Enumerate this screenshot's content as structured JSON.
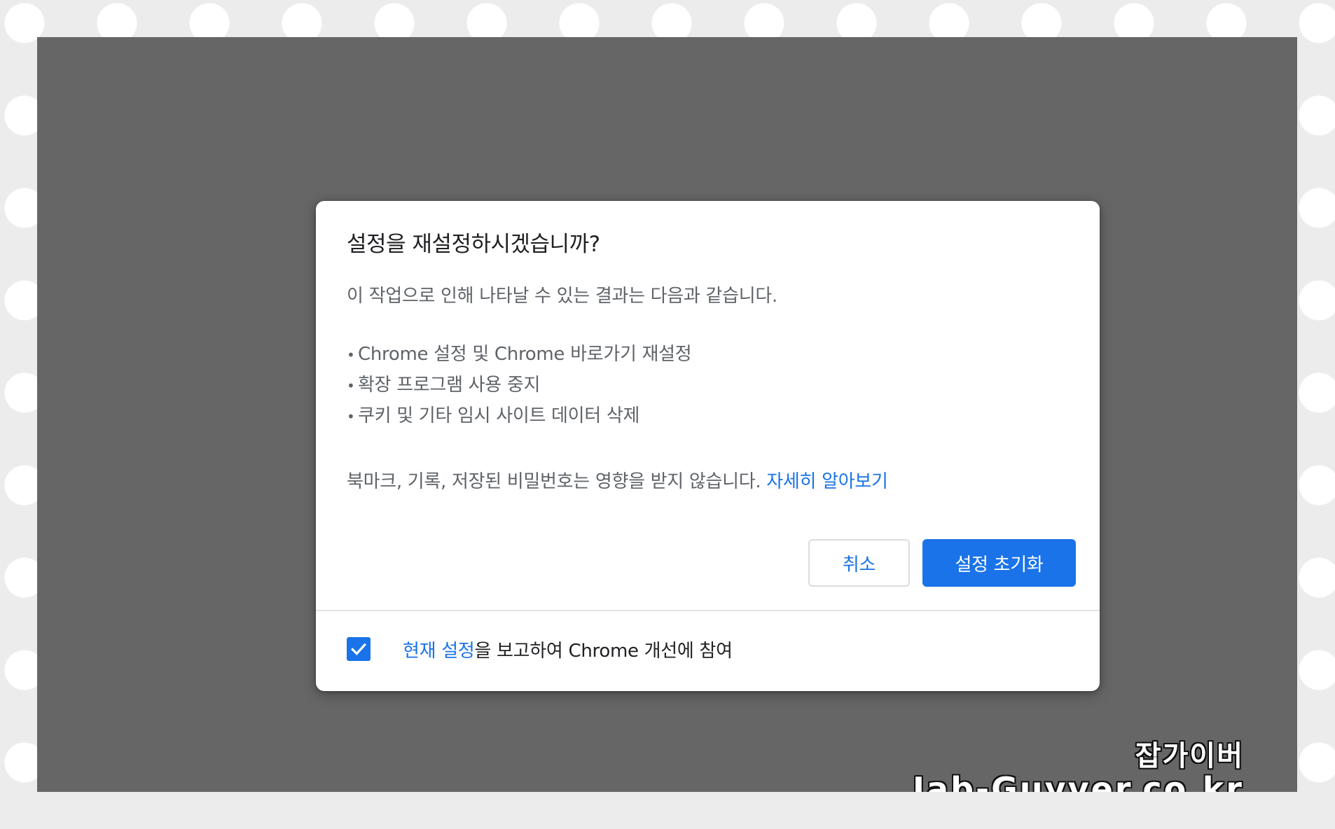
{
  "dialog": {
    "title": "설정을 재설정하시겠습니까?",
    "description": "이 작업으로 인해 나타날 수 있는 결과는 다음과 같습니다.",
    "effects": [
      "Chrome 설정 및 Chrome 바로가기 재설정",
      "확장 프로그램 사용 중지",
      "쿠키 및 기타 임시 사이트 데이터 삭제"
    ],
    "note": "북마크, 기록, 저장된 비밀번호는 영향을 받지 않습니다.",
    "learn_more_label": "자세히 알아보기",
    "cancel_label": "취소",
    "reset_label": "설정 초기화",
    "footer": {
      "checkbox_checked": true,
      "link_label": "현재 설정",
      "label_rest": "을 보고하여 Chrome 개선에 참여"
    }
  },
  "watermark": {
    "line1": "잡가이버",
    "line2": "Jab-Guyver.co.kr"
  },
  "colors": {
    "accent": "#1a73e8",
    "overlay": "#666666",
    "text_primary": "#202124",
    "text_secondary": "#5f6368"
  },
  "icons": {
    "checkbox": "check-icon"
  }
}
